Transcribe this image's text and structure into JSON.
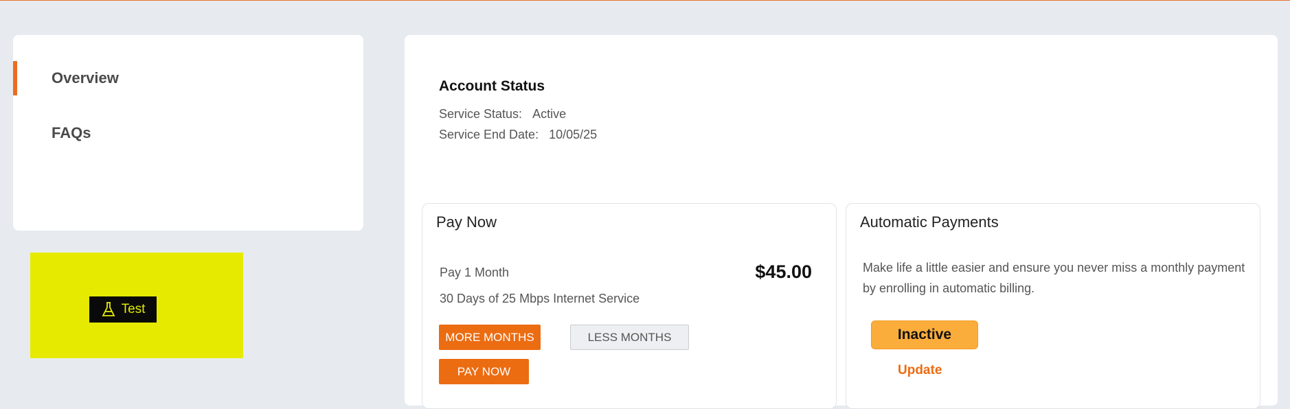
{
  "sidebar": {
    "items": [
      {
        "label": "Overview",
        "active": true
      },
      {
        "label": "FAQs",
        "active": false
      }
    ]
  },
  "test_widget": {
    "label": "Test",
    "icon": "flask-icon"
  },
  "account_status": {
    "title": "Account Status",
    "service_status_label": "Service Status:",
    "service_status_value": "Active",
    "service_end_label": "Service End Date:",
    "service_end_value": "10/05/25"
  },
  "pay_now": {
    "title": "Pay Now",
    "plan_label": "Pay 1 Month",
    "amount": "$45.00",
    "plan_description": "30 Days of 25 Mbps Internet Service",
    "more_months_label": "MORE MONTHS",
    "less_months_label": "LESS MONTHS",
    "pay_now_label": "PAY NOW"
  },
  "automatic_payments": {
    "title": "Automatic Payments",
    "description": "Make life a little easier and ensure you never miss a monthly payment by enrolling in automatic billing.",
    "status": "Inactive",
    "update_label": "Update"
  },
  "colors": {
    "accent": "#ec6c12",
    "status_inactive": "#fbad3c",
    "test_panel": "#e6ea00"
  }
}
